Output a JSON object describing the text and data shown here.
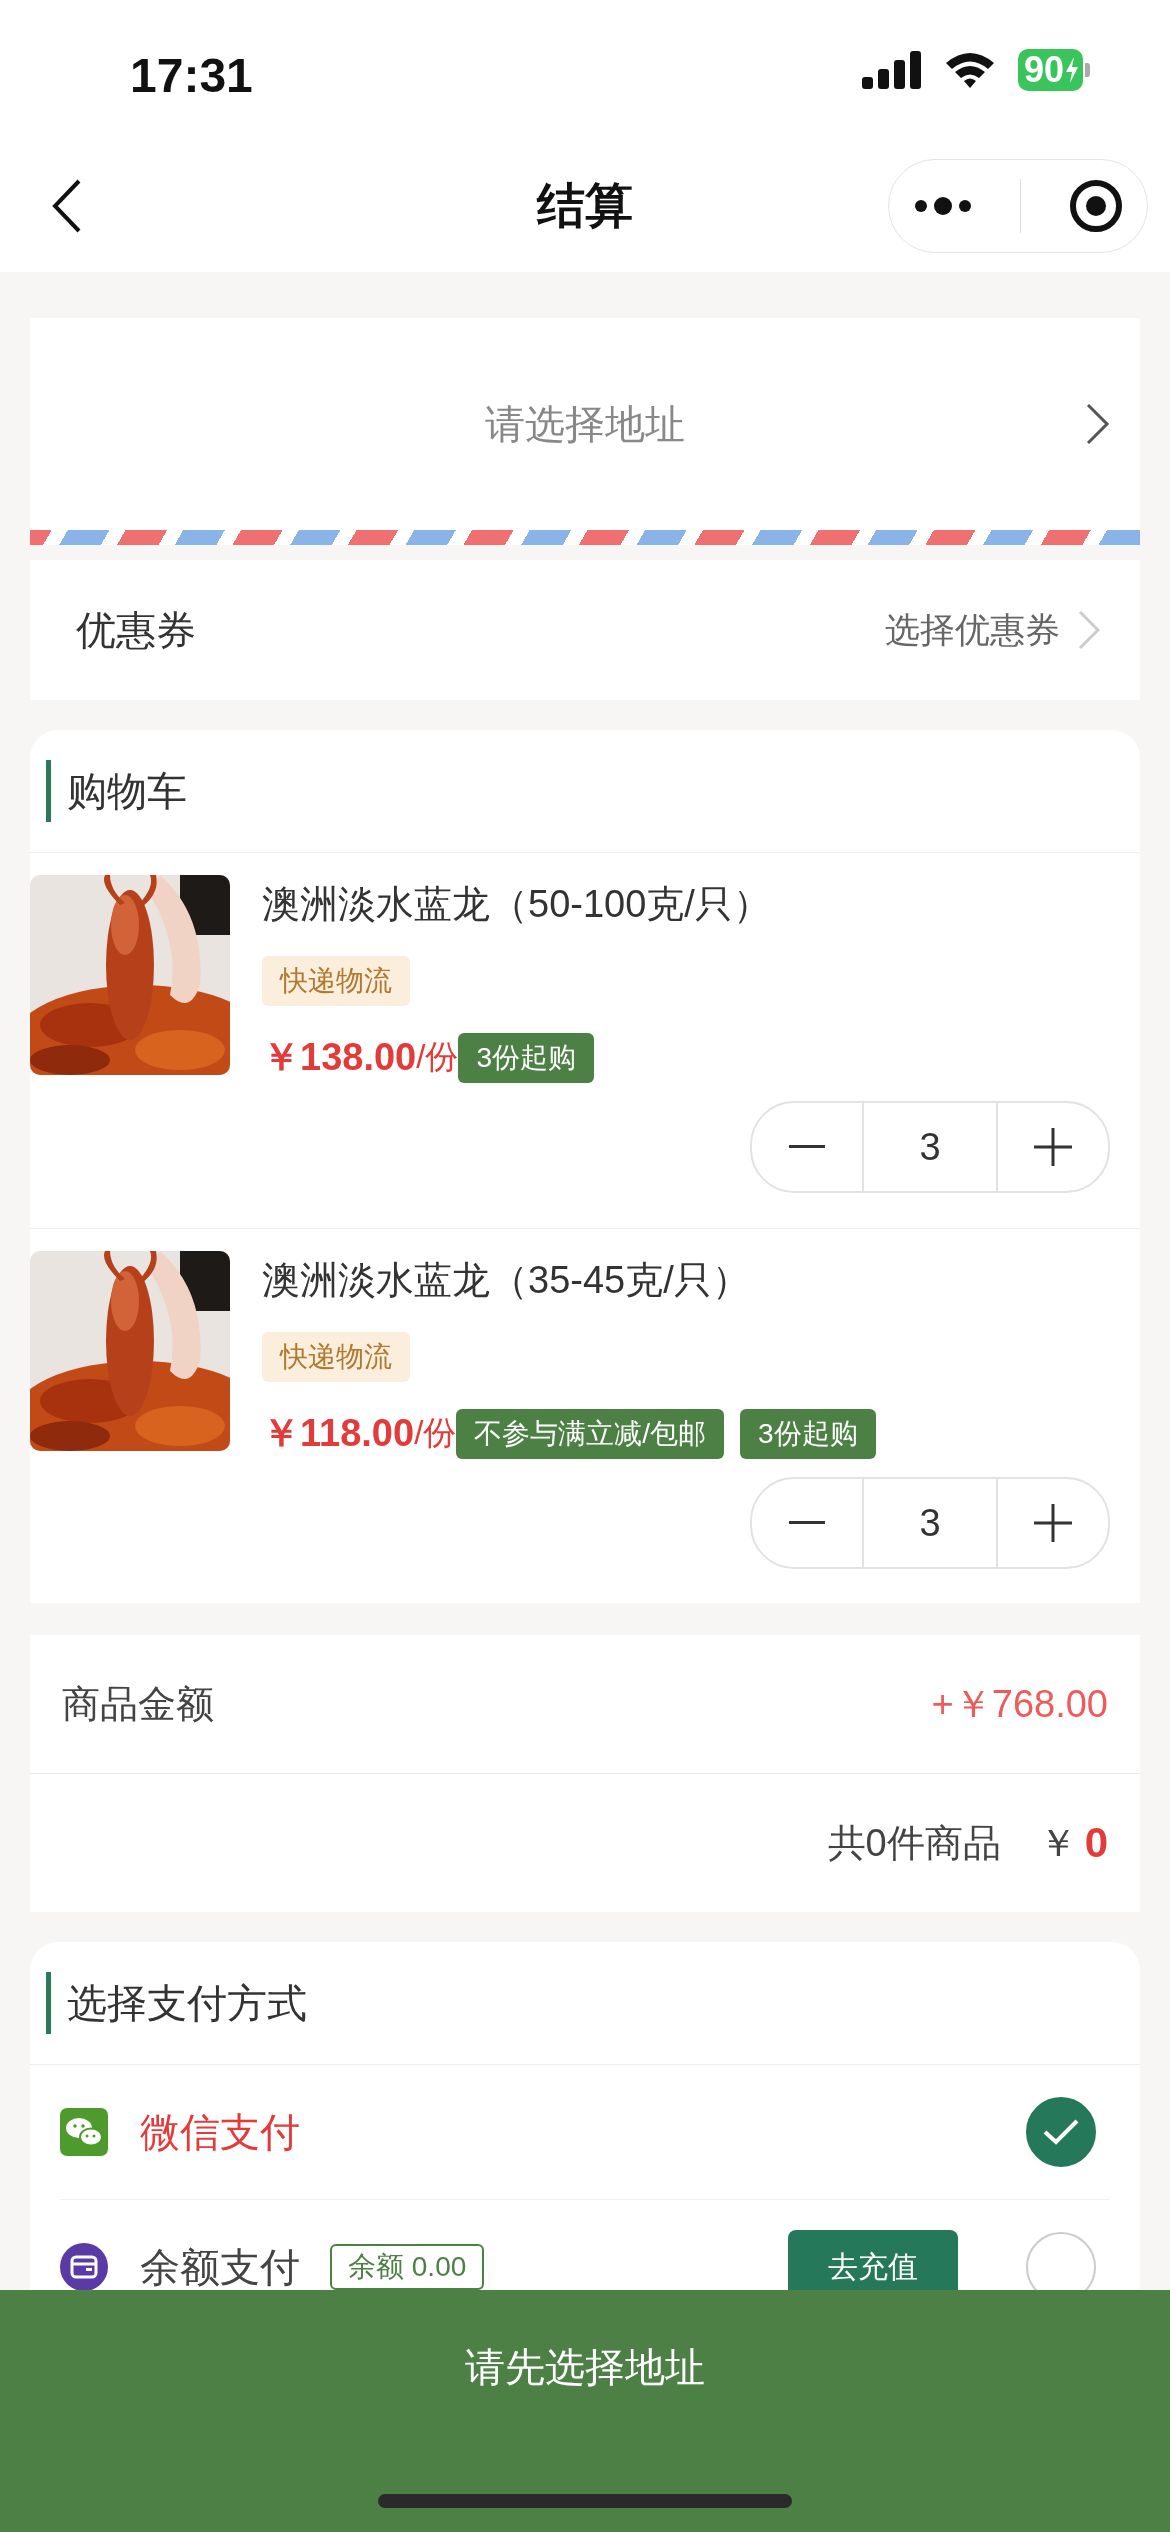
{
  "status_bar": {
    "time": "17:31",
    "battery": "90"
  },
  "nav": {
    "title": "结算"
  },
  "address": {
    "prompt": "请选择地址"
  },
  "coupon": {
    "label": "优惠券",
    "action": "选择优惠券"
  },
  "cart": {
    "title": "购物车",
    "items": [
      {
        "name": "澳洲淡水蓝龙（50-100克/只）",
        "shipping": "快递物流",
        "price": "￥138.00",
        "unit": "/份",
        "tags": [
          "3份起购"
        ],
        "quantity": "3"
      },
      {
        "name": "澳洲淡水蓝龙（35-45克/只）",
        "shipping": "快递物流",
        "price": "￥118.00",
        "unit": "/份",
        "tags": [
          "不参与满立减/包邮",
          "3份起购"
        ],
        "quantity": "3"
      }
    ]
  },
  "summary": {
    "label": "商品金额",
    "amount": "+￥768.00",
    "count": "共0件商品",
    "currency": "￥",
    "total": "0"
  },
  "payment": {
    "title": "选择支付方式",
    "methods": [
      {
        "kind": "wechat",
        "label": "微信支付",
        "selected": true
      },
      {
        "kind": "balance",
        "label": "余额支付",
        "balance": "余额 0.00",
        "action": "去充值",
        "selected": false
      }
    ]
  },
  "submit": {
    "label": "请先选择地址"
  }
}
